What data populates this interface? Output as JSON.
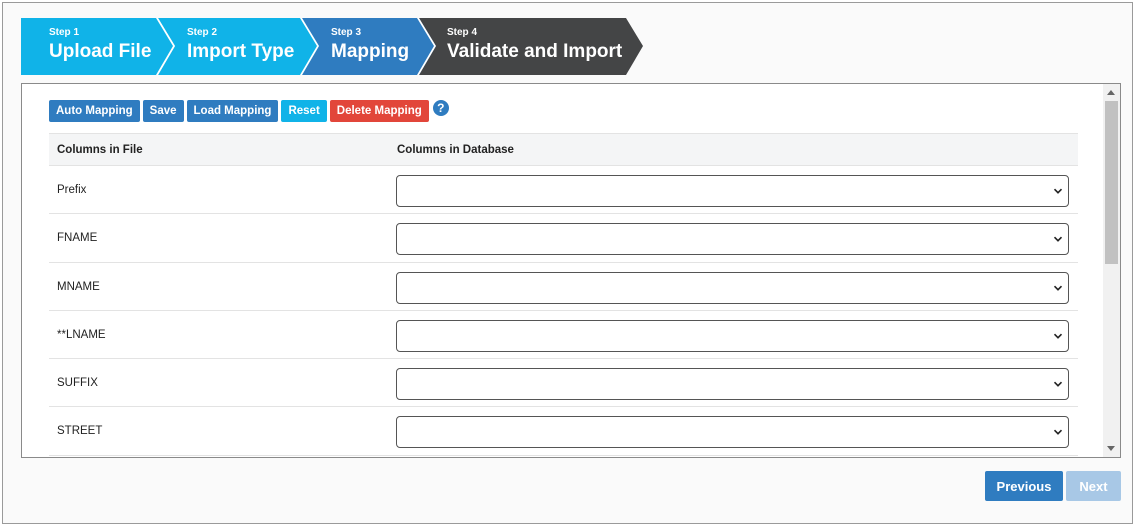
{
  "wizard": {
    "steps": [
      {
        "num": "Step 1",
        "title": "Upload File"
      },
      {
        "num": "Step 2",
        "title": "Import Type"
      },
      {
        "num": "Step 3",
        "title": "Mapping"
      },
      {
        "num": "Step 4",
        "title": "Validate and Import"
      }
    ],
    "active_step": "Step 3"
  },
  "toolbar": {
    "auto_mapping": "Auto Mapping",
    "save": "Save",
    "load_mapping": "Load Mapping",
    "reset": "Reset",
    "delete_mapping": "Delete Mapping",
    "help": "?"
  },
  "table": {
    "headers": {
      "file": "Columns in File",
      "database": "Columns in Database"
    },
    "rows": [
      {
        "file_column": "Prefix",
        "db_column": ""
      },
      {
        "file_column": "FNAME",
        "db_column": ""
      },
      {
        "file_column": "MNAME",
        "db_column": ""
      },
      {
        "file_column": "**LNAME",
        "db_column": ""
      },
      {
        "file_column": "SUFFIX",
        "db_column": ""
      },
      {
        "file_column": "STREET",
        "db_column": ""
      }
    ]
  },
  "nav": {
    "previous": "Previous",
    "next": "Next"
  },
  "colors": {
    "step_done": "#10b3e8",
    "step_active": "#2f7cc0",
    "step_pending": "#444546",
    "danger": "#e2463a"
  }
}
